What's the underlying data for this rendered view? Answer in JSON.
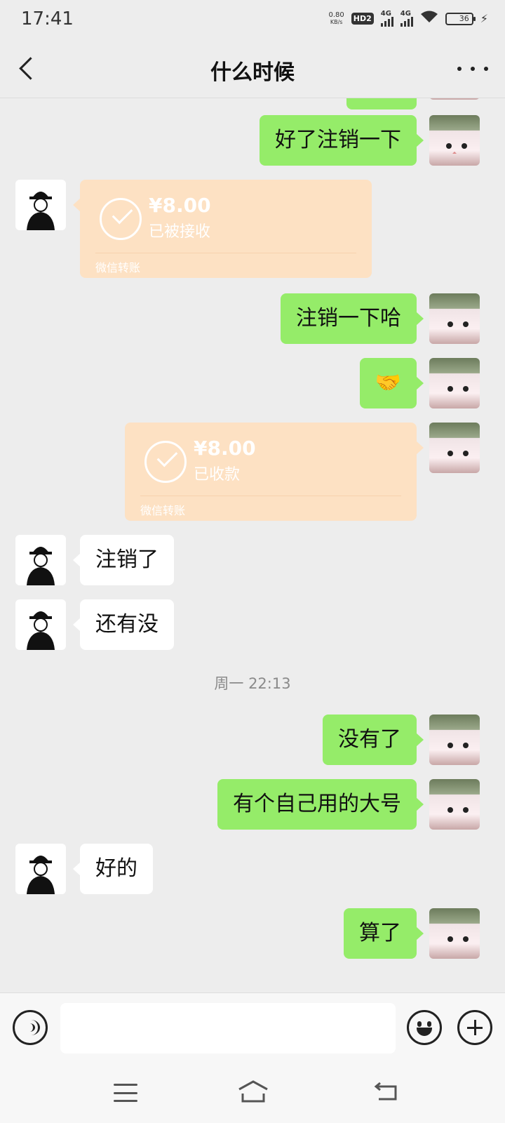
{
  "status_bar": {
    "time": "17:41",
    "net_speed_value": "0.80",
    "net_speed_unit": "KB/s",
    "hd_label": "HD2",
    "signal1_label": "4G",
    "signal2_label": "4G",
    "battery": "36"
  },
  "header": {
    "title": "什么时候"
  },
  "messages": [
    {
      "side": "me",
      "type": "text",
      "text": "好了注销一下"
    },
    {
      "side": "them",
      "type": "transfer",
      "amount": "¥8.00",
      "status": "已被接收",
      "source": "微信转账"
    },
    {
      "side": "me",
      "type": "text",
      "text": "注销一下哈"
    },
    {
      "side": "me",
      "type": "emoji",
      "text": "🤝"
    },
    {
      "side": "me",
      "type": "transfer",
      "amount": "¥8.00",
      "status": "已收款",
      "source": "微信转账"
    },
    {
      "side": "them",
      "type": "text",
      "text": "注销了"
    },
    {
      "side": "them",
      "type": "text",
      "text": "还有没"
    },
    {
      "type": "timestamp",
      "text": "周一 22:13"
    },
    {
      "side": "me",
      "type": "text",
      "text": "没有了"
    },
    {
      "side": "me",
      "type": "text",
      "text": "有个自己用的大号"
    },
    {
      "side": "them",
      "type": "text",
      "text": "好的"
    },
    {
      "side": "me",
      "type": "text",
      "text": "算了"
    }
  ],
  "input_bar": {
    "placeholder": ""
  },
  "colors": {
    "background": "#ededed",
    "my_bubble": "#95ec69",
    "their_bubble": "#ffffff",
    "transfer_card": "#fde1c3"
  }
}
